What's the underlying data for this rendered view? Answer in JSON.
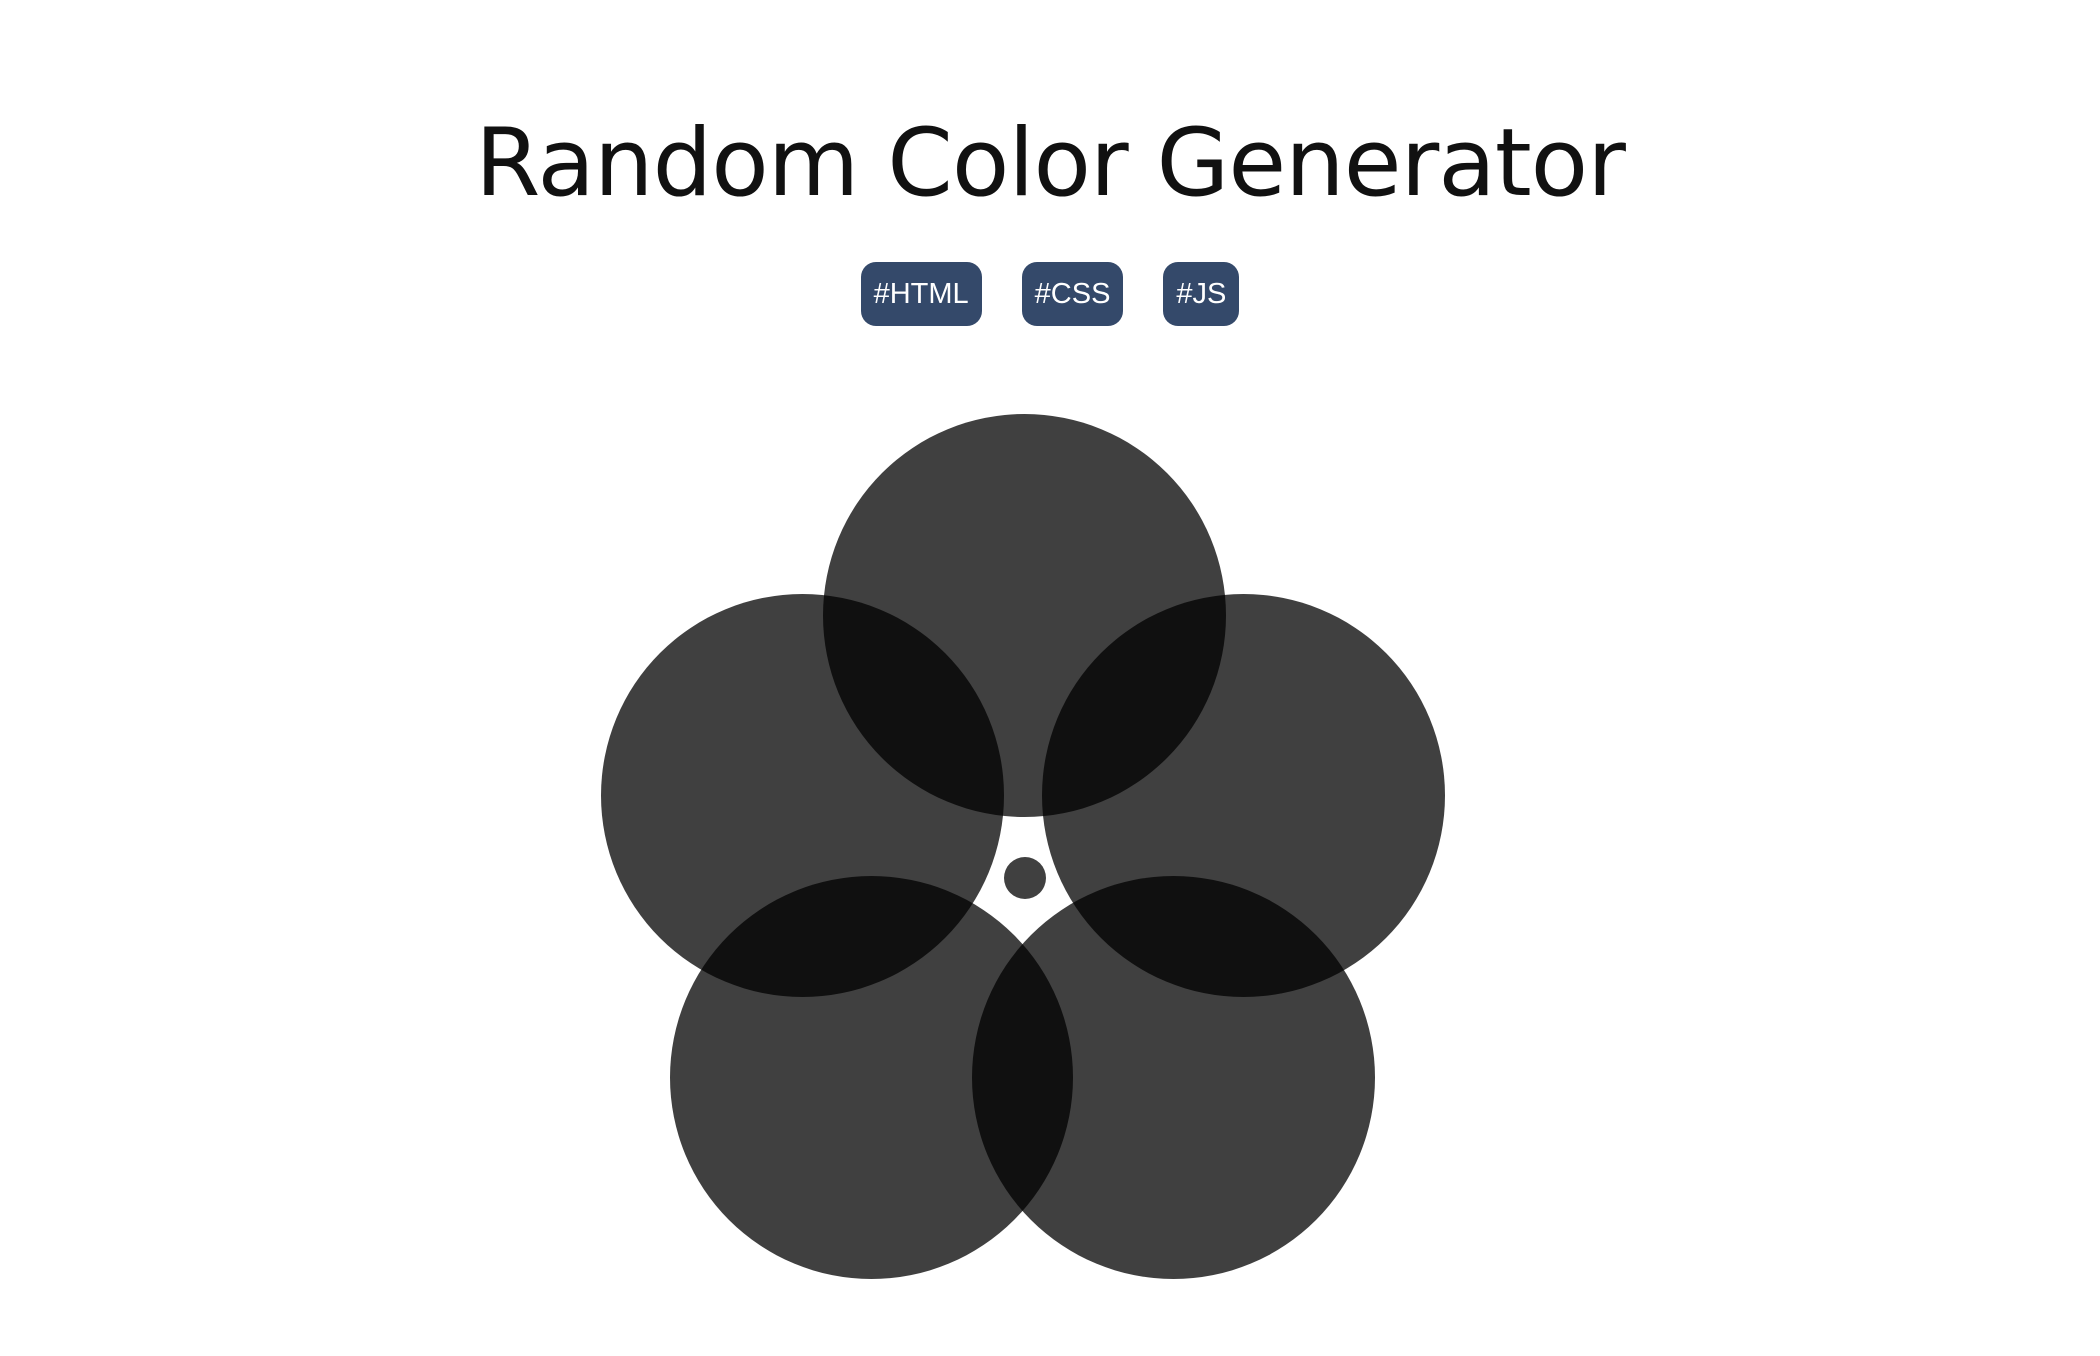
{
  "header": {
    "title": "Random Color Generator"
  },
  "tags": [
    {
      "label": "#HTML"
    },
    {
      "label": "#CSS"
    },
    {
      "label": "#JS"
    }
  ],
  "colors": {
    "tag_background": "#34496a",
    "petal_fill": "#000000",
    "petal_opacity": 0.75,
    "center_dot": "#404040",
    "background": "#ffffff"
  },
  "petals": [
    {
      "name": "petal-top"
    },
    {
      "name": "petal-left"
    },
    {
      "name": "petal-right"
    },
    {
      "name": "petal-bottom-left"
    },
    {
      "name": "petal-bottom-right"
    }
  ]
}
